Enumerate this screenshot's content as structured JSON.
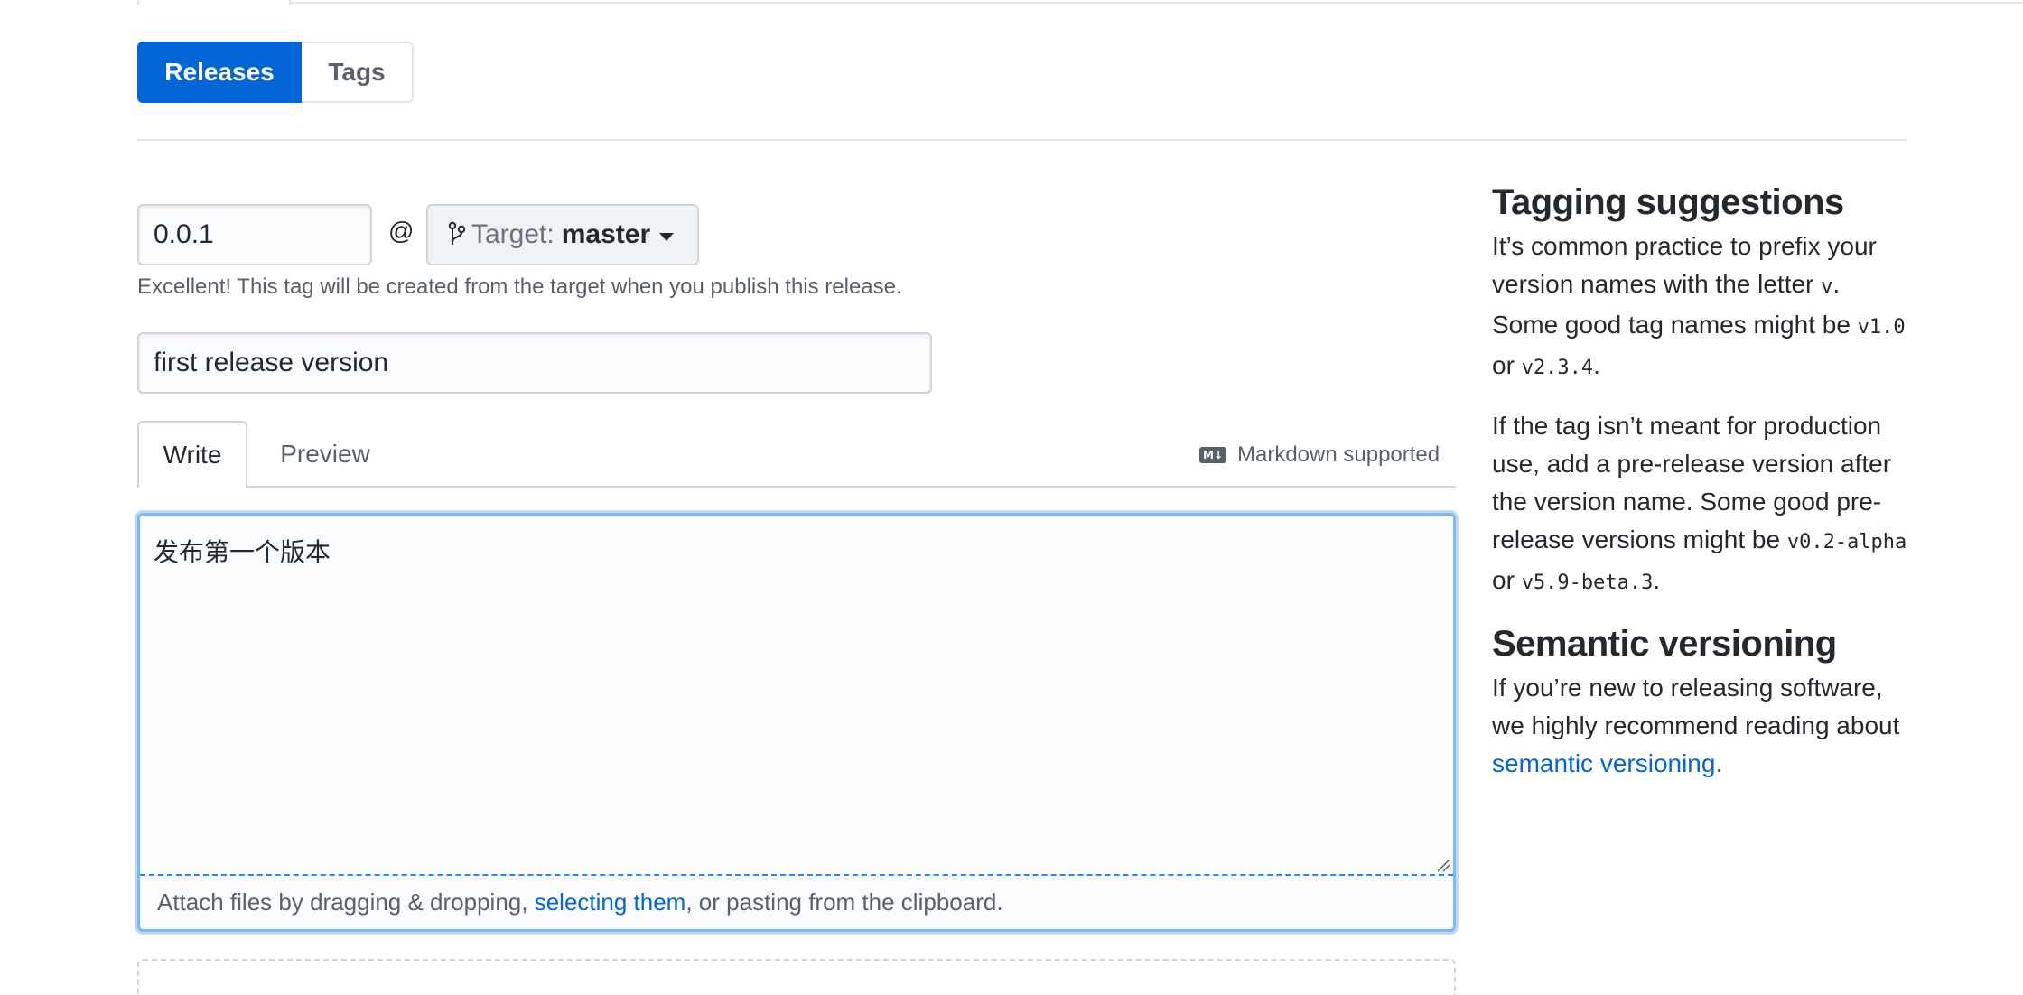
{
  "subnav": {
    "releases_label": "Releases",
    "tags_label": "Tags"
  },
  "release_form": {
    "tag_value": "0.0.1",
    "at_sign": "@",
    "target_label": "Target:",
    "target_value": "master",
    "tag_note": "Excellent! This tag will be created from the target when you publish this release.",
    "title_value": "first release version"
  },
  "editor": {
    "tab_write": "Write",
    "tab_preview": "Preview",
    "markdown_icon": "M↓",
    "markdown_hint": "Markdown supported",
    "body_value": "发布第一个版本",
    "attach_prefix": "Attach files by dragging & dropping, ",
    "attach_link": "selecting them",
    "attach_suffix": ", or pasting from the clipboard."
  },
  "sidebar": {
    "tagging_title": "Tagging suggestions",
    "tagging_p1_a": "It’s common practice to prefix your version names with the letter ",
    "tagging_p1_code1": "v",
    "tagging_p1_b": ". Some good tag names might be ",
    "tagging_p1_code2": "v1.0",
    "tagging_p1_c": " or ",
    "tagging_p1_code3": "v2.3.4",
    "tagging_p1_d": ".",
    "tagging_p2_a": "If the tag isn’t meant for production use, add a pre-release version after the version name. Some good pre-release versions might be ",
    "tagging_p2_code1": "v0.2-alpha",
    "tagging_p2_b": " or ",
    "tagging_p2_code2": "v5.9-beta.3",
    "tagging_p2_c": ".",
    "semver_title": "Semantic versioning",
    "semver_p_a": "If you’re new to releasing software, we highly recommend reading about ",
    "semver_link": "semantic versioning."
  },
  "colors": {
    "accent": "#0366d6",
    "focus_border": "#79b8ff",
    "muted": "#586069"
  },
  "icons": {
    "branch": "git-branch-icon",
    "caret": "caret-down-icon",
    "markdown": "markdown-icon",
    "resize": "resize-grip-icon"
  }
}
